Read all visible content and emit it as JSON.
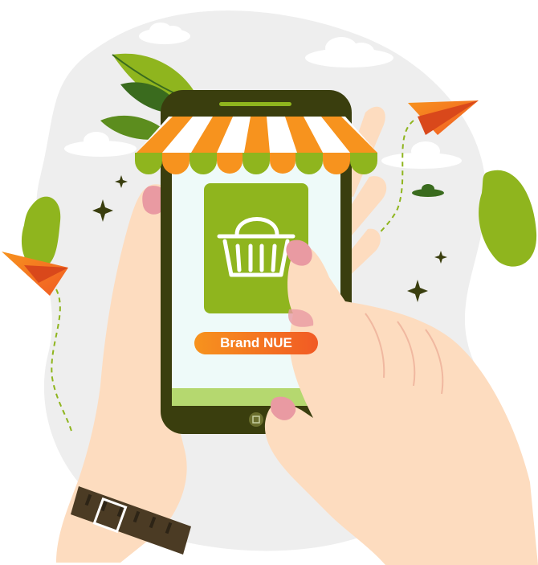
{
  "brand": {
    "label": "Brand NUE"
  },
  "colors": {
    "background_blob": "#eeeeee",
    "phone_body": "#3a3e0e",
    "screen": "#eefaf9",
    "tile_green": "#8fb51e",
    "awning_orange": "#f7931e",
    "awning_green": "#8fb51e",
    "skin": "#fddcbf",
    "nail": "#e99aa2",
    "plane_orange": "#f15a24"
  },
  "icons": {
    "basket": "shopping-basket-icon",
    "home": "home-button-icon"
  }
}
